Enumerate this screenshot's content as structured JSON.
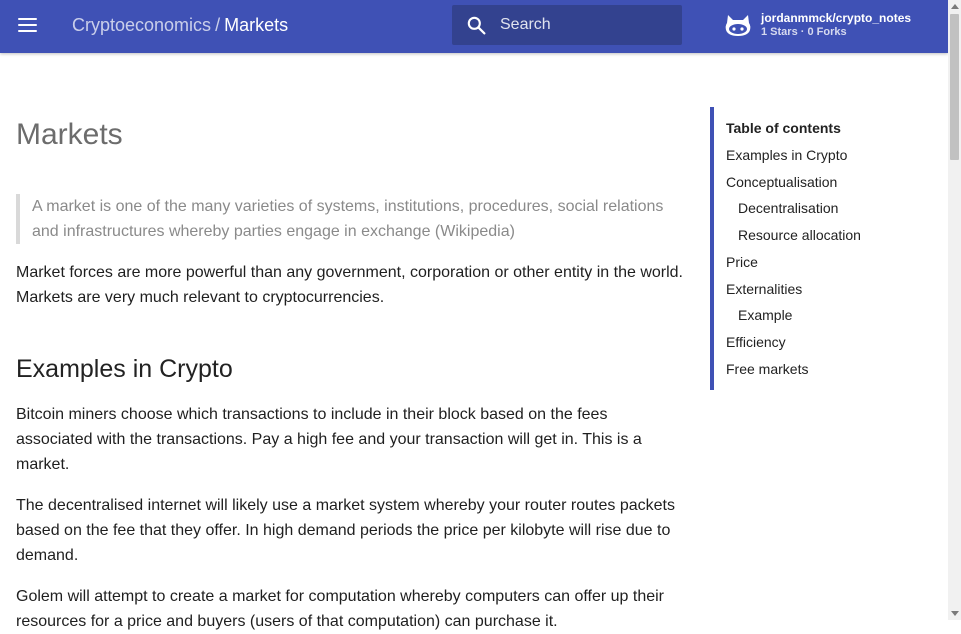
{
  "header": {
    "site_name": "Cryptoeconomics",
    "separator": "/",
    "page_name": "Markets",
    "search_placeholder": "Search",
    "repo_name": "jordanmmck/crypto_notes",
    "repo_facts": "1 Stars · 0 Forks"
  },
  "article": {
    "title": "Markets",
    "quote": "A market is one of the many varieties of systems, institutions, procedures, social relations and infrastructures whereby parties engage in exchange (Wikipedia)",
    "intro": "Market forces are more powerful than any government, corporation or other entity in the world. Markets are very much relevant to cryptocurrencies.",
    "section_heading": "Examples in Crypto",
    "paragraphs": [
      "Bitcoin miners choose which transactions to include in their block based on the fees associated with the transactions. Pay a high fee and your transaction will get in. This is a market.",
      "The decentralised internet will likely use a market system whereby your router routes packets based on the fee that they offer. In high demand periods the price per kilobyte will rise due to demand.",
      "Golem will attempt to create a market for computation whereby computers can offer up their resources for a price and buyers (users of that computation) can purchase it."
    ]
  },
  "toc": {
    "title": "Table of contents",
    "items": [
      {
        "label": "Examples in Crypto"
      },
      {
        "label": "Conceptualisation"
      },
      {
        "label": "Decentralisation"
      },
      {
        "label": "Resource allocation"
      },
      {
        "label": "Price"
      },
      {
        "label": "Externalities"
      },
      {
        "label": "Example"
      },
      {
        "label": "Efficiency"
      },
      {
        "label": "Free markets"
      }
    ]
  },
  "icons": {
    "menu": "menu-icon",
    "search": "search-icon",
    "repo": "github-icon"
  },
  "colors": {
    "primary": "#3f51b5",
    "search_bg": "#33428f"
  }
}
